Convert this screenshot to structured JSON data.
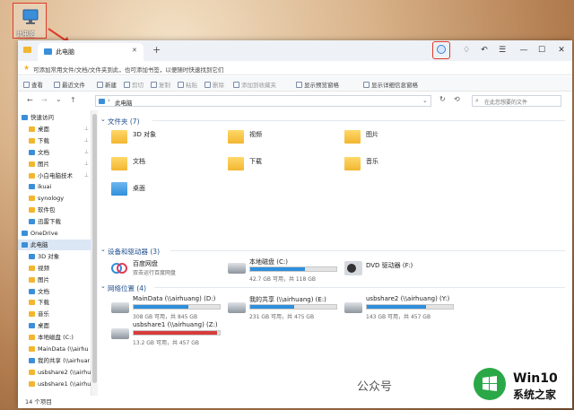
{
  "desktop": {
    "icon_label": "此电脑"
  },
  "annotation": {
    "question_mark": "?"
  },
  "window": {
    "tab_title": "此电脑",
    "new_tab": "+",
    "controls": {
      "minimize": "—",
      "maximize": "☐",
      "close": "✕"
    },
    "infobar": "可添加常用文件/文档/文件夹到此，也可添加书签，以便随时快速找到它们",
    "toolbar": {
      "view": "查看",
      "recent": "最近文件",
      "new": "新建",
      "cut": "剪切",
      "copy": "复制",
      "paste": "粘贴",
      "delete": "删除",
      "add_bookmark": "添加到收藏夹",
      "show_preview": "显示预览窗格",
      "show_details": "显示详细信息窗格"
    },
    "address": "此电脑",
    "search_placeholder": "在此您想要的文件",
    "sidebar": [
      {
        "label": "快速访问",
        "level": 0
      },
      {
        "label": "桌面",
        "level": 1,
        "pinned": true
      },
      {
        "label": "下载",
        "level": 1,
        "pinned": true
      },
      {
        "label": "文档",
        "level": 1,
        "pinned": true
      },
      {
        "label": "图片",
        "level": 1,
        "pinned": true
      },
      {
        "label": "小白电脑技术",
        "level": 1,
        "pinned": true
      },
      {
        "label": "ikuai",
        "level": 1
      },
      {
        "label": "synology",
        "level": 1
      },
      {
        "label": "软件包",
        "level": 1
      },
      {
        "label": "迅雷下载",
        "level": 1
      },
      {
        "label": "OneDrive",
        "level": 0
      },
      {
        "label": "此电脑",
        "level": 0,
        "selected": true
      },
      {
        "label": "3D 对象",
        "level": 1
      },
      {
        "label": "视频",
        "level": 1
      },
      {
        "label": "图片",
        "level": 1
      },
      {
        "label": "文档",
        "level": 1
      },
      {
        "label": "下载",
        "level": 1
      },
      {
        "label": "音乐",
        "level": 1
      },
      {
        "label": "桌面",
        "level": 1
      },
      {
        "label": "本地磁盘 (C:)",
        "level": 1
      },
      {
        "label": "MainData (\\\\airhu",
        "level": 1
      },
      {
        "label": "我的共享 (\\\\airhuar",
        "level": 1
      },
      {
        "label": "usbshare2 (\\\\airhu",
        "level": 1
      },
      {
        "label": "usbshare1 (\\\\airhu",
        "level": 1
      }
    ],
    "status": "14 个项目",
    "sections": {
      "folders": "文件夹 (7)",
      "devices": "设备和驱动器 (3)",
      "network": "网络位置 (4)"
    },
    "folders": [
      "3D 对象",
      "视频",
      "图片",
      "文档",
      "下载",
      "音乐",
      "桌面"
    ],
    "devices": [
      {
        "name": "百度网盘",
        "sub": "双击运行百度网盘"
      },
      {
        "name": "本地磁盘 (C:)",
        "sub": "42.7 GB 可用，共 118 GB",
        "used": 0.64
      },
      {
        "name": "DVD 驱动器 (F:)",
        "sub": ""
      }
    ],
    "network": [
      {
        "name": "MainData (\\\\airhuang) (D:)",
        "sub": "308 GB 可用，共 845 GB",
        "used": 0.64
      },
      {
        "name": "我的共享 (\\\\airhuang) (E:)",
        "sub": "231 GB 可用，共 475 GB",
        "used": 0.51
      },
      {
        "name": "usbshare2 (\\\\airhuang) (Y:)",
        "sub": "143 GB 可用，共 457 GB",
        "used": 0.69
      },
      {
        "name": "usbshare1 (\\\\airhuang) (Z:)",
        "sub": "13.2 GB 可用，共 457 GB",
        "used": 0.97
      }
    ]
  },
  "watermark": {
    "wechat": "公众号",
    "brand": "Win10",
    "site": "系统之家"
  },
  "colors": {
    "accent": "#2f8fdc",
    "warning_bar": "#d83b3b",
    "annotation": "#e03b2a"
  }
}
